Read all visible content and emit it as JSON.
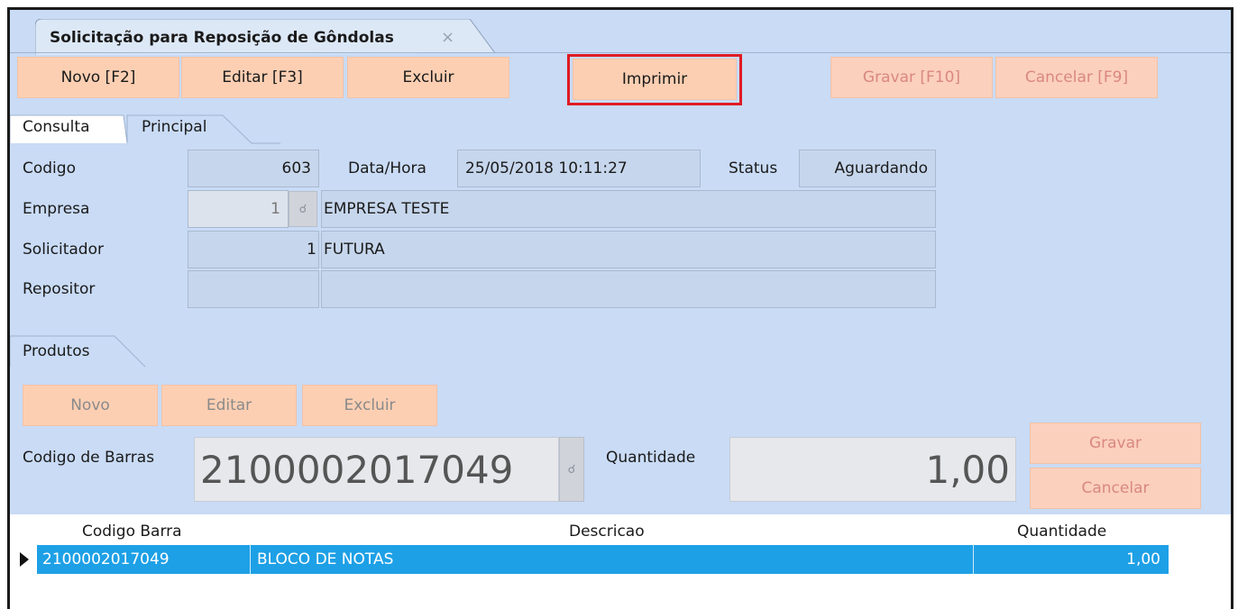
{
  "window": {
    "tab_title": "Solicitação para Reposição de Gôndolas",
    "tab_close": "×"
  },
  "toolbar": {
    "novo": "Novo [F2]",
    "editar": "Editar [F3]",
    "excluir": "Excluir",
    "imprimir": "Imprimir",
    "gravar": "Gravar [F10]",
    "cancelar": "Cancelar [F9]"
  },
  "tabs": [
    "Consulta",
    "Principal"
  ],
  "form": {
    "codigo_label": "Codigo",
    "codigo_value": "603",
    "datahora_label": "Data/Hora",
    "datahora_value": "25/05/2018 10:11:27",
    "status_label": "Status",
    "status_value": "Aguardando",
    "empresa_label": "Empresa",
    "empresa_code": "1",
    "empresa_name": "EMPRESA TESTE",
    "solicitador_label": "Solicitador",
    "solicitador_code": "1",
    "solicitador_name": "FUTURA",
    "repositor_label": "Repositor",
    "repositor_code": "",
    "repositor_name": ""
  },
  "produtos": {
    "tab_label": "Produtos",
    "novo": "Novo",
    "editar": "Editar",
    "excluir": "Excluir",
    "codigo_barras_label": "Codigo de Barras",
    "codigo_barras_value": "2100002017049",
    "quantidade_label": "Quantidade",
    "quantidade_value": "1,00",
    "gravar": "Gravar",
    "cancelar": "Cancelar"
  },
  "grid": {
    "columns": [
      "Codigo Barra",
      "Descricao",
      "Quantidade"
    ],
    "rows": [
      {
        "codigo": "2100002017049",
        "descricao": "BLOCO DE NOTAS",
        "quantidade": "1,00"
      }
    ]
  },
  "colors": {
    "panel_bg": "#c9dbf5",
    "button_bg": "#fccfb3",
    "highlight": "#e01b24",
    "selected_row": "#1ea0e6"
  }
}
